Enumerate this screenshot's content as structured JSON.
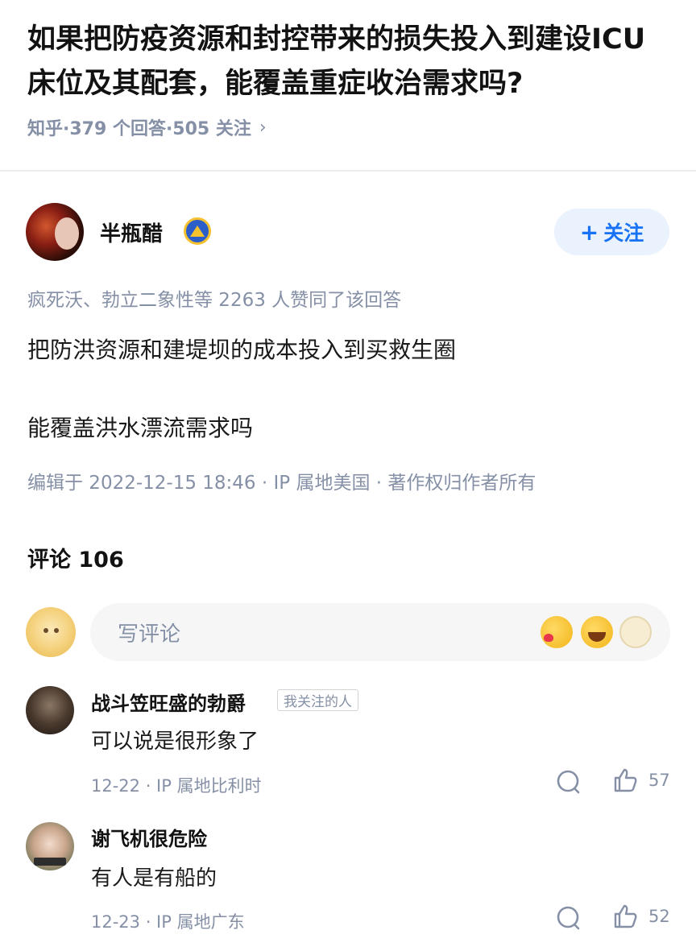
{
  "question": {
    "title": "如果把防疫资源和封控带来的损失投入到建设ICU床位及其配套，能覆盖重症收治需求吗?",
    "meta": "知乎·379 个回答·505 关注",
    "chevron": "›"
  },
  "answer": {
    "author_name": "半瓶醋",
    "follow_button": {
      "plus": "+",
      "label": "关注"
    },
    "likers_text": "疯死沃、勃立二象性等 2263 人赞同了该回答",
    "paragraphs": [
      "把防洪资源和建堤坝的成本投入到买救生圈",
      "能覆盖洪水漂流需求吗"
    ],
    "edit_meta": "编辑于 2022-12-15 18:46 · IP 属地美国 · 著作权归作者所有"
  },
  "comments_section": {
    "header": "评论 106",
    "input_placeholder": "写评论",
    "emoji_icons": [
      "kiss-emoji-icon",
      "laugh-cry-emoji-icon",
      "thinking-emoji-icon"
    ]
  },
  "comments": [
    {
      "name": "战斗笠旺盛的勃爵",
      "tag": "我关注的人",
      "text": "可以说是很形象了",
      "meta": "12-22 · IP 属地比利时",
      "likes": "57"
    },
    {
      "name": "谢飞机很危险",
      "tag": "",
      "text": "有人是有船的",
      "meta": "12-23 · IP 属地广东",
      "likes": "52"
    }
  ],
  "colors": {
    "accent": "#1772f6",
    "follow_bg": "#eaf2fd",
    "meta_gray": "#8590a6",
    "input_bg": "#f6f6f6"
  }
}
